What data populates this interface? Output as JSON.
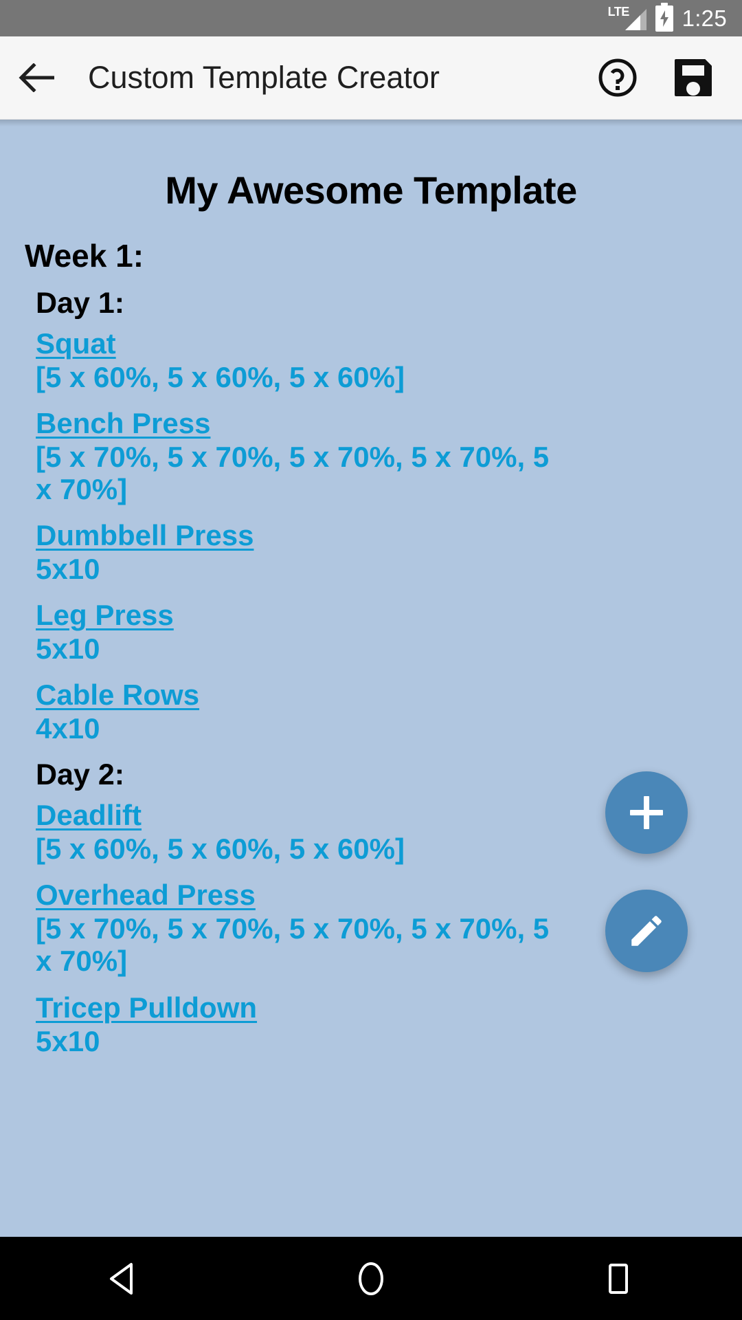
{
  "status_bar": {
    "network_label": "LTE",
    "network_icon": "signal-bars-icon",
    "battery_icon": "battery-charging-icon",
    "time": "1:25"
  },
  "app_bar": {
    "back_icon": "back-arrow-icon",
    "title": "Custom Template Creator",
    "help_icon": "help-circle-icon",
    "save_icon": "save-floppy-icon"
  },
  "content": {
    "template_title": "My Awesome Template",
    "weeks": [
      {
        "label": "Week 1:",
        "days": [
          {
            "label": "Day 1:",
            "exercises": [
              {
                "name": "Squat",
                "sets": "[5 x 60%, 5 x 60%, 5 x 60%]"
              },
              {
                "name": "Bench Press",
                "sets": "[5 x 70%, 5 x 70%, 5 x 70%, 5 x 70%, 5 x 70%]"
              },
              {
                "name": "Dumbbell Press",
                "sets": "5x10"
              },
              {
                "name": "Leg Press",
                "sets": "5x10"
              },
              {
                "name": "Cable Rows",
                "sets": "4x10"
              }
            ]
          },
          {
            "label": "Day 2:",
            "exercises": [
              {
                "name": "Deadlift",
                "sets": "[5 x 60%, 5 x 60%, 5 x 60%]"
              },
              {
                "name": "Overhead Press",
                "sets": "[5 x 70%, 5 x 70%, 5 x 70%, 5 x 70%, 5 x 70%]"
              },
              {
                "name": "Tricep Pulldown",
                "sets": "5x10"
              }
            ]
          }
        ]
      }
    ]
  },
  "fabs": {
    "add_icon": "plus-icon",
    "edit_icon": "pencil-icon"
  },
  "nav_bar": {
    "back_icon": "nav-back-triangle-icon",
    "home_icon": "nav-home-circle-icon",
    "recents_icon": "nav-recents-square-icon"
  },
  "colors": {
    "status_bar_bg": "#767676",
    "app_bar_bg": "#f6f6f6",
    "content_bg": "#b0c6e0",
    "link_blue": "#0d9cd5",
    "fab_blue": "#4a87b8",
    "nav_bar_bg": "#000000"
  }
}
